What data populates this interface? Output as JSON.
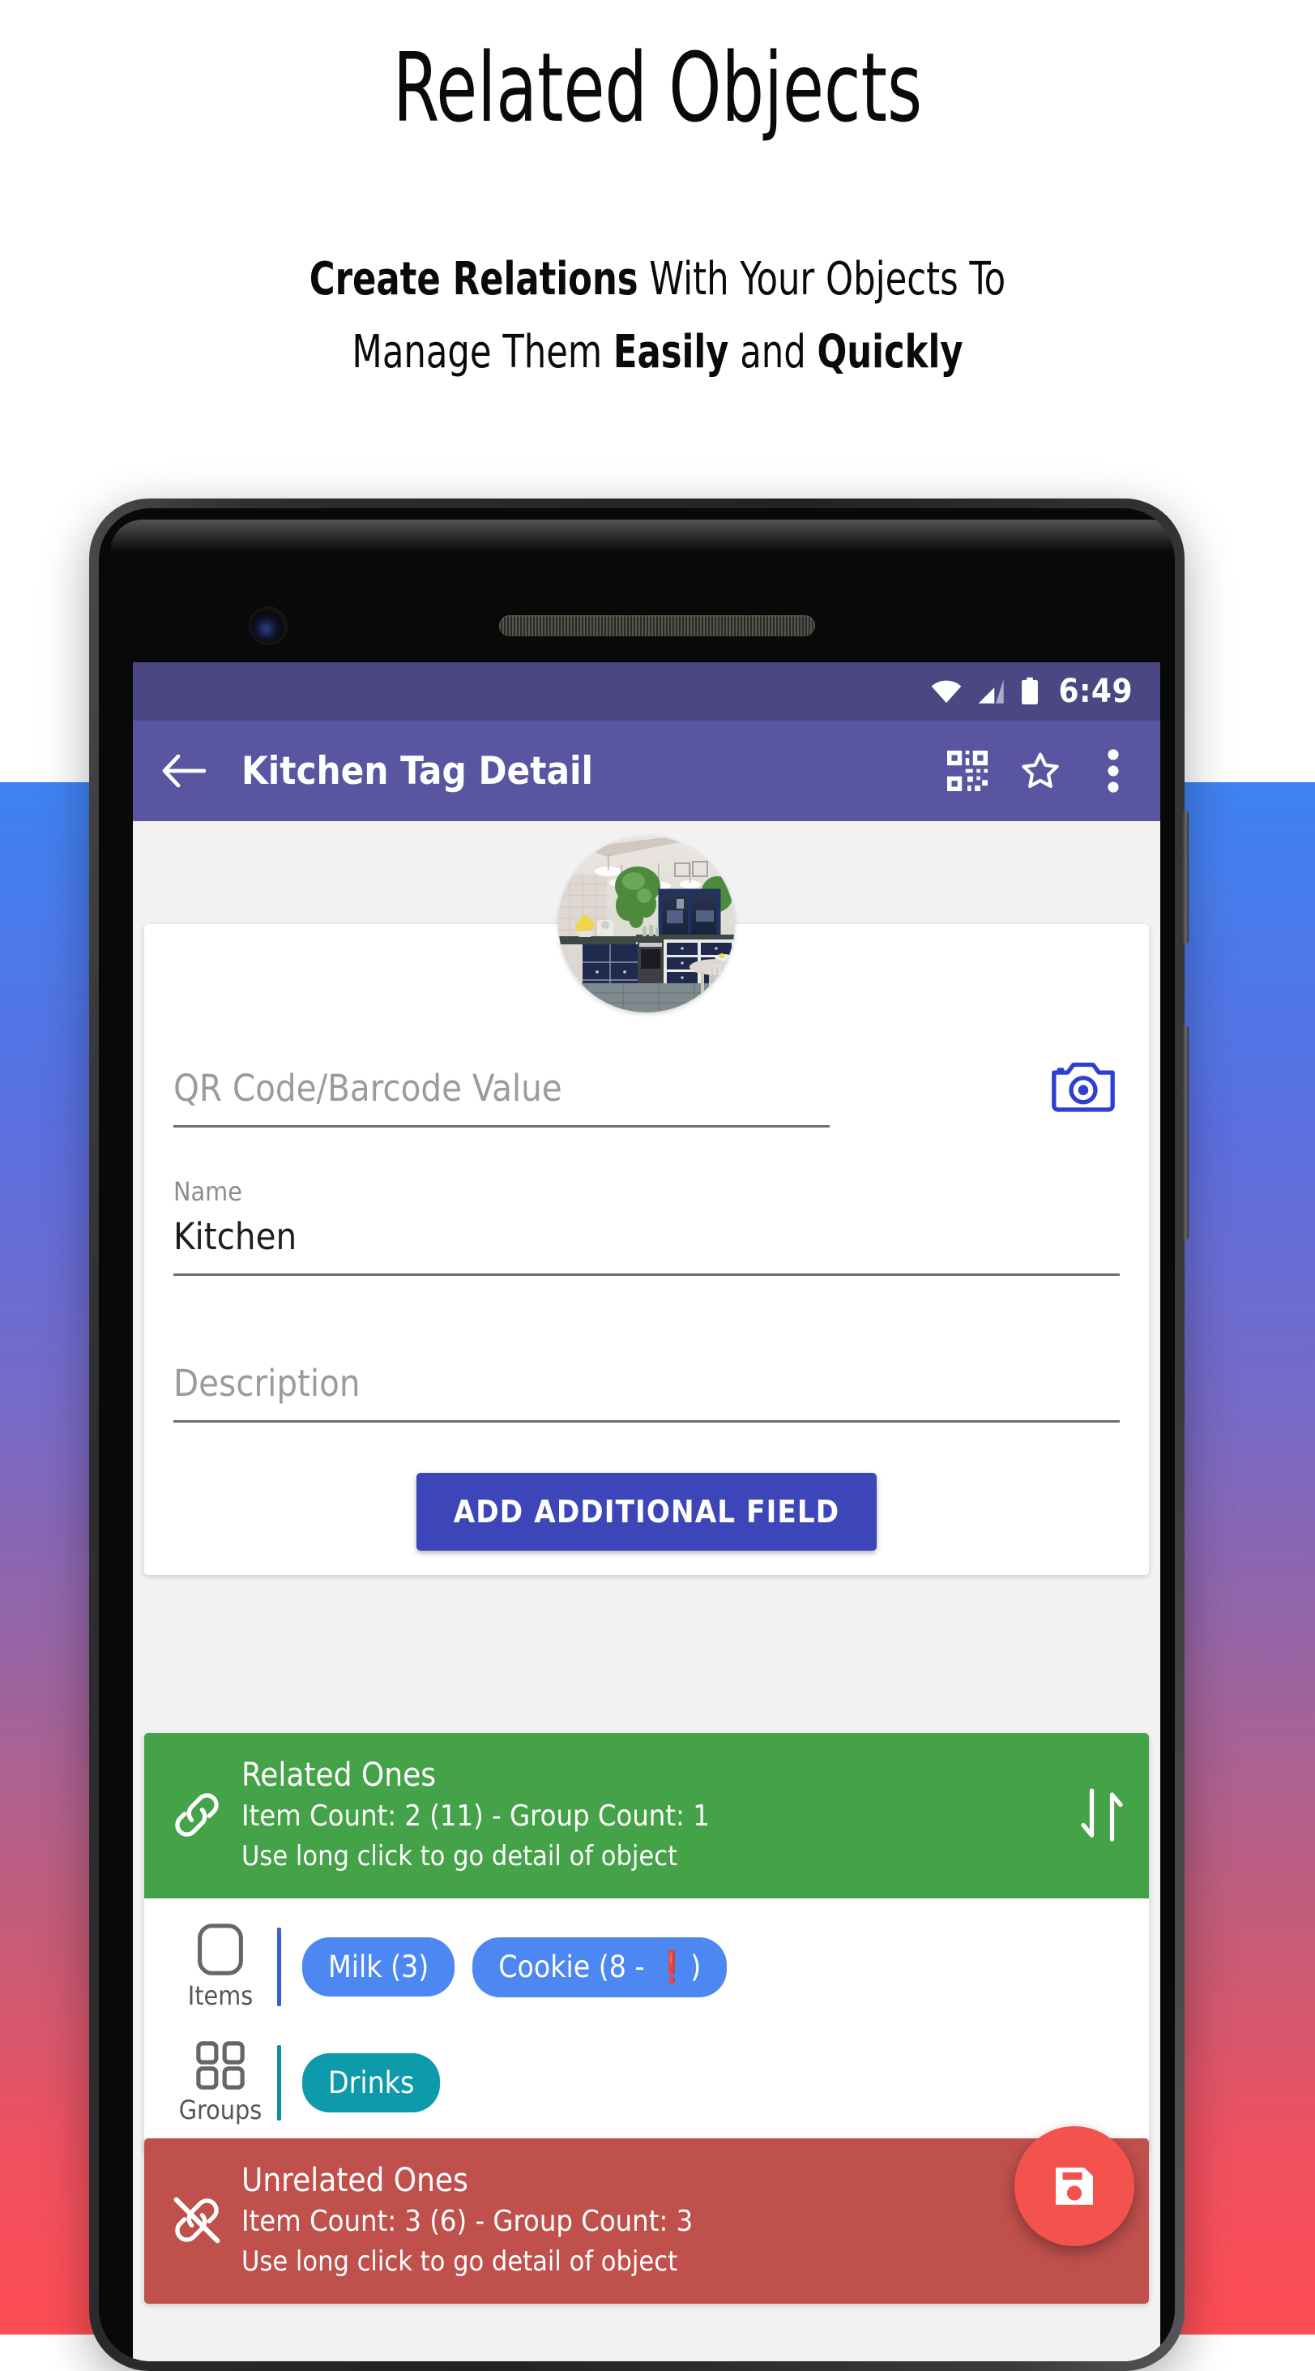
{
  "promo": {
    "title": "Related Objects",
    "subtitle_line1_bold": "Create Relations",
    "subtitle_line1_rest": " With Your Objects To",
    "subtitle_line2_a": "Manage Them ",
    "subtitle_line2_bold1": "Easily",
    "subtitle_line2_b": " and ",
    "subtitle_line2_bold2": "Quickly"
  },
  "status_bar": {
    "clock": "6:49",
    "wifi_icon": "wifi-icon",
    "signal_icon": "cellular-signal-icon",
    "battery_icon": "battery-full-icon"
  },
  "app_bar": {
    "back_icon": "back-arrow-icon",
    "title": "Kitchen Tag Detail",
    "qr_icon": "qr-code-icon",
    "star_icon": "star-outline-icon",
    "overflow_icon": "more-vertical-icon"
  },
  "form": {
    "avatar_name": "kitchen-photo",
    "qr_field": {
      "label": "QR Code/Barcode Value",
      "value": "",
      "placeholder": "QR Code/Barcode Value",
      "camera_icon": "camera-icon"
    },
    "name_field": {
      "label": "Name",
      "value": "Kitchen",
      "placeholder": "Name"
    },
    "description_field": {
      "label": "Description",
      "value": "",
      "placeholder": "Description"
    },
    "add_field_button": "ADD ADDITIONAL FIELD"
  },
  "related": {
    "title": "Related Ones",
    "count": "Item Count: 2 (11) - Group Count: 1",
    "hint": "Use long click to go detail of object",
    "link_icon": "link-icon",
    "sort_icon": "sort-arrows-icon",
    "color": "#44a248",
    "rows": [
      {
        "label": "Items",
        "icon": "item-square-icon",
        "divider_color": "#3b5fd0",
        "chips": [
          {
            "text": "Milk (3)",
            "color": "blue",
            "warning": ""
          },
          {
            "text": "Cookie (8 - ",
            "color": "blue",
            "warning": "❗",
            "suffix": ")"
          }
        ]
      },
      {
        "label": "Groups",
        "icon": "group-grid-icon",
        "divider_color": "#0e8fa0",
        "chips": [
          {
            "text": "Drinks",
            "color": "teal",
            "warning": ""
          }
        ]
      }
    ]
  },
  "unrelated": {
    "title": "Unrelated Ones",
    "count": "Item Count: 3 (6) - Group Count: 3",
    "hint": "Use long click to go detail of object",
    "broken_link_icon": "broken-link-icon",
    "color": "#bf504c"
  },
  "fab": {
    "icon": "save-floppy-icon",
    "color": "#f4534d"
  },
  "theme": {
    "status_bar_color": "#4a4783",
    "app_bar_color": "#5a55a0",
    "primary_button_color": "#3c46b8",
    "gradient_top": "#3f82f2",
    "gradient_bottom": "#ff4d55"
  }
}
